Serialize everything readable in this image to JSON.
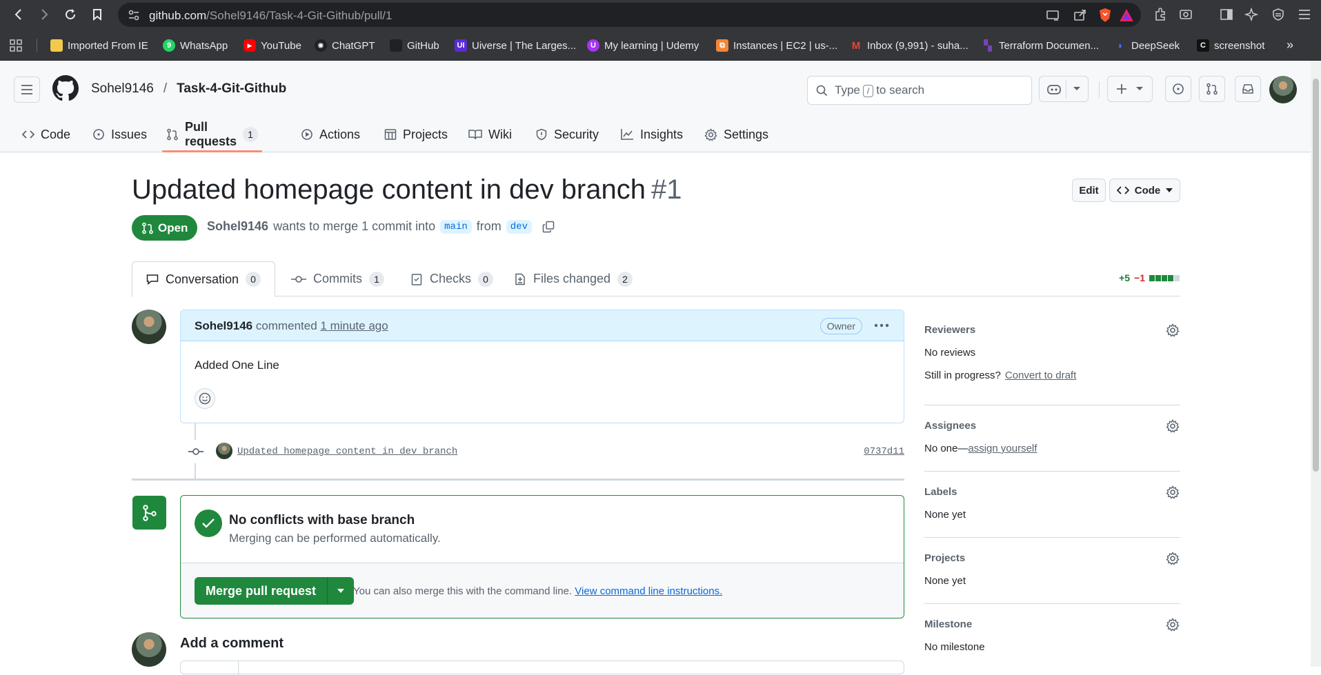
{
  "browser": {
    "url_domain": "github.com",
    "url_path": "/Sohel9146/Task-4-Git-Github/pull/1",
    "bookmarks": [
      {
        "label": "Imported From IE",
        "icon": "folder-icon",
        "color": "#f2c94c"
      },
      {
        "label": "WhatsApp",
        "icon": "whatsapp-icon",
        "color": "#25d366"
      },
      {
        "label": "YouTube",
        "icon": "youtube-icon",
        "color": "#ff0000"
      },
      {
        "label": "ChatGPT",
        "icon": "chatgpt-icon",
        "color": "#202124"
      },
      {
        "label": "GitHub",
        "icon": "github-icon",
        "color": "#202124"
      },
      {
        "label": "Uiverse | The Larges...",
        "icon": "uiverse-icon",
        "color": "#5b2bd6"
      },
      {
        "label": "My learning | Udemy",
        "icon": "udemy-icon",
        "color": "#a435f0"
      },
      {
        "label": "Instances | EC2 | us-...",
        "icon": "aws-icon",
        "color": "#f58536"
      },
      {
        "label": "Inbox (9,991) - suha...",
        "icon": "gmail-icon",
        "color": "#ea4335"
      },
      {
        "label": "Terraform Documen...",
        "icon": "terraform-icon",
        "color": "#7b42bc"
      },
      {
        "label": "DeepSeek",
        "icon": "deepseek-icon",
        "color": "#4d6bfe"
      },
      {
        "label": "screenshot",
        "icon": "screenshot-icon",
        "color": "#111111"
      }
    ]
  },
  "header": {
    "owner": "Sohel9146",
    "separator": "/",
    "repo": "Task-4-Git-Github",
    "search_pre": "Type",
    "search_key": "/",
    "search_post": "to search"
  },
  "repo_tabs": [
    {
      "label": "Code",
      "icon": "code-icon"
    },
    {
      "label": "Issues",
      "icon": "issue-opened-icon"
    },
    {
      "label": "Pull requests",
      "icon": "git-pull-request-icon",
      "count": "1",
      "active": true
    },
    {
      "label": "Actions",
      "icon": "play-icon"
    },
    {
      "label": "Projects",
      "icon": "table-icon"
    },
    {
      "label": "Wiki",
      "icon": "book-icon"
    },
    {
      "label": "Security",
      "icon": "shield-icon"
    },
    {
      "label": "Insights",
      "icon": "graph-icon"
    },
    {
      "label": "Settings",
      "icon": "gear-icon"
    }
  ],
  "pr": {
    "title": "Updated homepage content in dev branch",
    "number": "#1",
    "edit_label": "Edit",
    "code_label": "Code",
    "state": "Open",
    "author": "Sohel9146",
    "merge_text_1": "wants to merge 1 commit into",
    "base_branch": "main",
    "merge_text_2": "from",
    "head_branch": "dev"
  },
  "pr_tabs": [
    {
      "label": "Conversation",
      "count": "0",
      "active": true
    },
    {
      "label": "Commits",
      "count": "1"
    },
    {
      "label": "Checks",
      "count": "0"
    },
    {
      "label": "Files changed",
      "count": "2"
    }
  ],
  "diffstat": {
    "additions": "+5",
    "deletions": "−1",
    "blocks": [
      1,
      1,
      1,
      1,
      0
    ]
  },
  "comment": {
    "author": "Sohel9146",
    "verb": "commented",
    "time": "1 minute ago",
    "role": "Owner",
    "body": "Added One Line"
  },
  "commit": {
    "message": "Updated homepage content in dev branch",
    "sha": "0737d11"
  },
  "merge": {
    "status_title": "No conflicts with base branch",
    "status_sub": "Merging can be performed automatically.",
    "button": "Merge pull request",
    "hint": "You can also merge this with the command line.",
    "hint_link": "View command line instructions."
  },
  "add_comment": {
    "title": "Add a comment"
  },
  "sidebar": [
    {
      "label": "Reviewers",
      "lines": [
        {
          "text": "No reviews"
        },
        {
          "text": "Still in progress?",
          "link": "Convert to draft"
        }
      ]
    },
    {
      "label": "Assignees",
      "lines": [
        {
          "text": "No one—",
          "link": "assign yourself"
        }
      ]
    },
    {
      "label": "Labels",
      "lines": [
        {
          "text": "None yet"
        }
      ]
    },
    {
      "label": "Projects",
      "lines": [
        {
          "text": "None yet"
        }
      ]
    },
    {
      "label": "Milestone",
      "lines": [
        {
          "text": "No milestone"
        }
      ]
    }
  ],
  "colors": {
    "accent_green": "#1f883d",
    "tab_underline": "#fd8c73",
    "link_blue": "#0969da"
  }
}
